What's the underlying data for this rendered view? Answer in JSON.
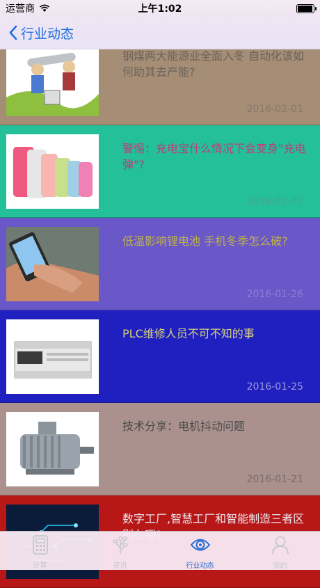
{
  "status_bar": {
    "carrier": "运营商",
    "time": "上午1:02",
    "wifi_icon": "wifi-icon",
    "battery_level": 1.0
  },
  "nav": {
    "back_icon": "chevron-left-icon",
    "title": "行业动态"
  },
  "articles": [
    {
      "title": "钢煤两大能源业全面入冬 自动化该如何助其去产能?",
      "date": "2016-02-01",
      "bg": "#a58d76",
      "title_color": "#6b6359",
      "date_color": "#8a7a6a",
      "image": "illustration-cartoon"
    },
    {
      "title": "警惕：充电宝什么情况下会变身\"充电弹\"?",
      "date": "2016-01-27",
      "bg": "#23c09a",
      "title_color": "#c03a7a",
      "date_color": "#4aa38a",
      "image": "power-banks"
    },
    {
      "title": "低温影响锂电池 手机冬季怎么破?",
      "date": "2016-01-26",
      "bg": "#6a57c8",
      "title_color": "#bdb34a",
      "date_color": "#8a80d8",
      "image": "hand-phone"
    },
    {
      "title": "PLC维修人员不可不知的事",
      "date": "2016-01-25",
      "bg": "#2020c0",
      "title_color": "#d8d27a",
      "date_color": "#9a9adf",
      "image": "plc-device"
    },
    {
      "title": "技术分享：电机抖动问题",
      "date": "2016-01-21",
      "bg": "#aa918e",
      "title_color": "#4a4a4a",
      "date_color": "#7a6a68",
      "image": "electric-motor"
    },
    {
      "title": "数字工厂,智慧工厂和智能制造三者区别在哪?",
      "date": "",
      "bg": "#b81717",
      "title_color": "#e7e7ee",
      "date_color": "#e7e7ee",
      "image": "digital-circuit"
    }
  ],
  "tab_bar": [
    {
      "label": "计算",
      "icon": "calculator-icon",
      "active": false
    },
    {
      "label": "资讯",
      "icon": "tree-icon",
      "active": false
    },
    {
      "label": "行业动态",
      "icon": "eye-icon",
      "active": true
    },
    {
      "label": "我的",
      "icon": "user-icon",
      "active": false
    }
  ],
  "colors": {
    "accent": "#1f6fe0",
    "tab_active": "#2a6fd6",
    "tab_inactive": "#c7c7cc"
  }
}
